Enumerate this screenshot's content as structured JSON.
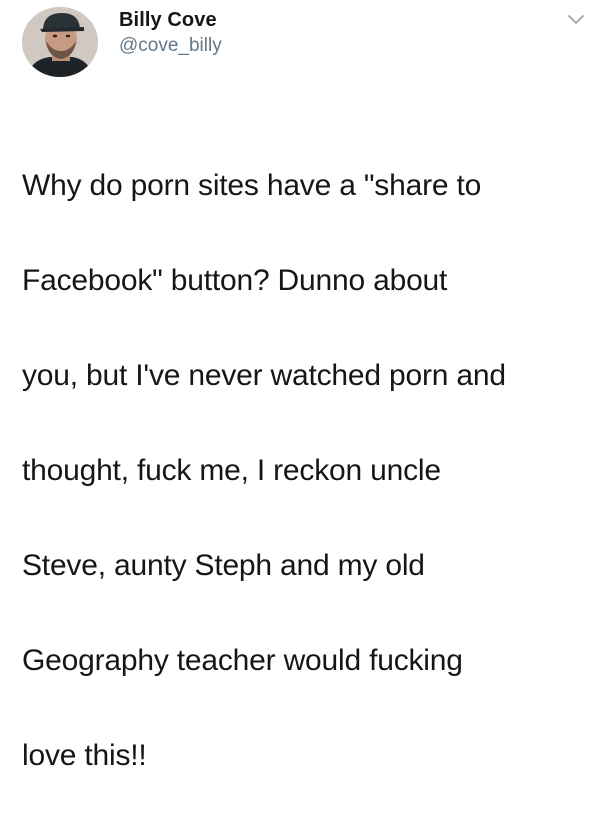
{
  "tweet": {
    "author": {
      "display_name": "Billy Cove",
      "handle": "@cove_billy",
      "avatar_icon": "profile-photo"
    },
    "menu_icon": "chevron-down-icon",
    "text_lines": [
      "Why do porn sites have a \"share to",
      "Facebook\" button? Dunno about",
      "you, but I've never watched porn and",
      "thought, fuck me, I reckon uncle",
      "Steve, aunty Steph and my old",
      "Geography teacher would fucking",
      "love this!!"
    ]
  },
  "colors": {
    "text": "#14171a",
    "secondary_text": "#657786",
    "background": "#ffffff"
  }
}
